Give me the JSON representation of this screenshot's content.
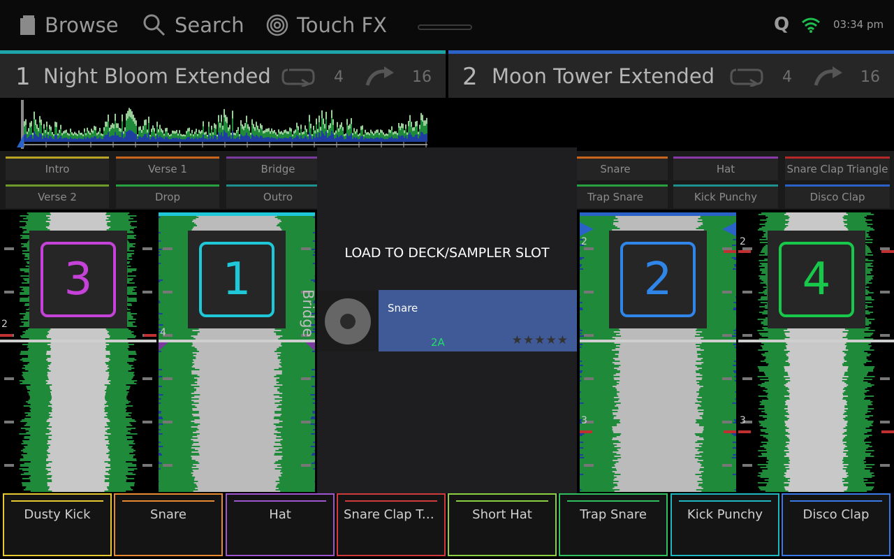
{
  "topbar": {
    "browse_label": "Browse",
    "search_label": "Search",
    "touchfx_label": "Touch FX",
    "q_label": "Q",
    "time": "03:34 pm",
    "icons": {
      "browse": "browse-icon",
      "search": "search-icon",
      "touchfx": "touch-fx-icon",
      "wifi": "wifi-icon"
    }
  },
  "decks": [
    {
      "number": "1",
      "title": "Night Bloom Extended",
      "loop_value": "4",
      "jump_value": "16",
      "accent": "#1ea3a8"
    },
    {
      "number": "2",
      "title": "Moon Tower Extended",
      "loop_value": "4",
      "jump_value": "16",
      "accent": "#2a62c8"
    }
  ],
  "cues_left": [
    {
      "label": "Intro",
      "color": "#b8a424"
    },
    {
      "label": "Verse 1",
      "color": "#c9661b"
    },
    {
      "label": "Bridge",
      "color": "#7b3a9e"
    },
    {
      "label": "Verse 2",
      "color": "#6e9a2a"
    },
    {
      "label": "Drop",
      "color": "#27a040"
    },
    {
      "label": "Outro",
      "color": "#1d9090"
    }
  ],
  "cues_right": [
    {
      "label": "Snare",
      "color": "#c9661b"
    },
    {
      "label": "Hat",
      "color": "#8a3aa8"
    },
    {
      "label": "Snare Clap Triangle",
      "color": "#b62828"
    },
    {
      "label": "Trap Snare",
      "color": "#27a040"
    },
    {
      "label": "Kick Punchy",
      "color": "#1d9090"
    },
    {
      "label": "Disco Clap",
      "color": "#2a62c8"
    }
  ],
  "deck_boxes": [
    {
      "number": "3",
      "color": "#c542d8"
    },
    {
      "number": "1",
      "color": "#1ec8d8"
    },
    {
      "number": "2",
      "color": "#2f86e8"
    },
    {
      "number": "4",
      "color": "#18c84a"
    }
  ],
  "waveform_labels": {
    "col1_beat_a": "2",
    "col2_beat_a": "4",
    "col2_section": "Bridge",
    "col3_beat_a": "2",
    "col3_beat_b": "3",
    "col4_beat_a": "2",
    "col4_beat_b": "3"
  },
  "modal": {
    "title": "LOAD TO DECK/SAMPLER SLOT",
    "item": {
      "name": "Snare",
      "key": "2A",
      "stars": "★★★★★",
      "rating": 0
    }
  },
  "sampler_pads": [
    {
      "label": "Dusty Kick",
      "color": "#e8c830"
    },
    {
      "label": "Snare",
      "color": "#e88a30"
    },
    {
      "label": "Hat",
      "color": "#a055d0"
    },
    {
      "label": "Snare Clap Triangle",
      "color": "#d03a3a"
    },
    {
      "label": "Short Hat",
      "color": "#8ad040"
    },
    {
      "label": "Trap Snare",
      "color": "#30c060"
    },
    {
      "label": "Kick Punchy",
      "color": "#20b8c0"
    },
    {
      "label": "Disco Clap",
      "color": "#3a7ae8"
    }
  ]
}
